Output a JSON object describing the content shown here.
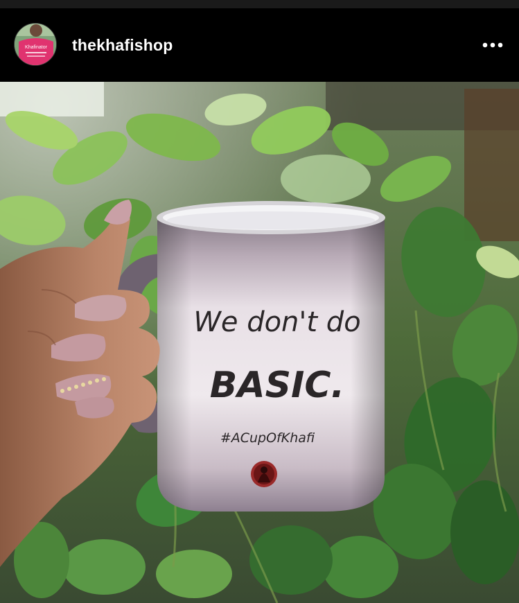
{
  "post": {
    "username": "thekhafishop",
    "avatar_text": "Khafinator",
    "more_icon": "more-horizontal-icon"
  },
  "photo": {
    "mug": {
      "line1": "We don't do",
      "line2": "BASIC.",
      "hashtag": "#ACupOfKhafi"
    }
  },
  "colors": {
    "header_bg": "#000000",
    "username": "#ffffff",
    "avatar_shirt": "#e0336f"
  }
}
